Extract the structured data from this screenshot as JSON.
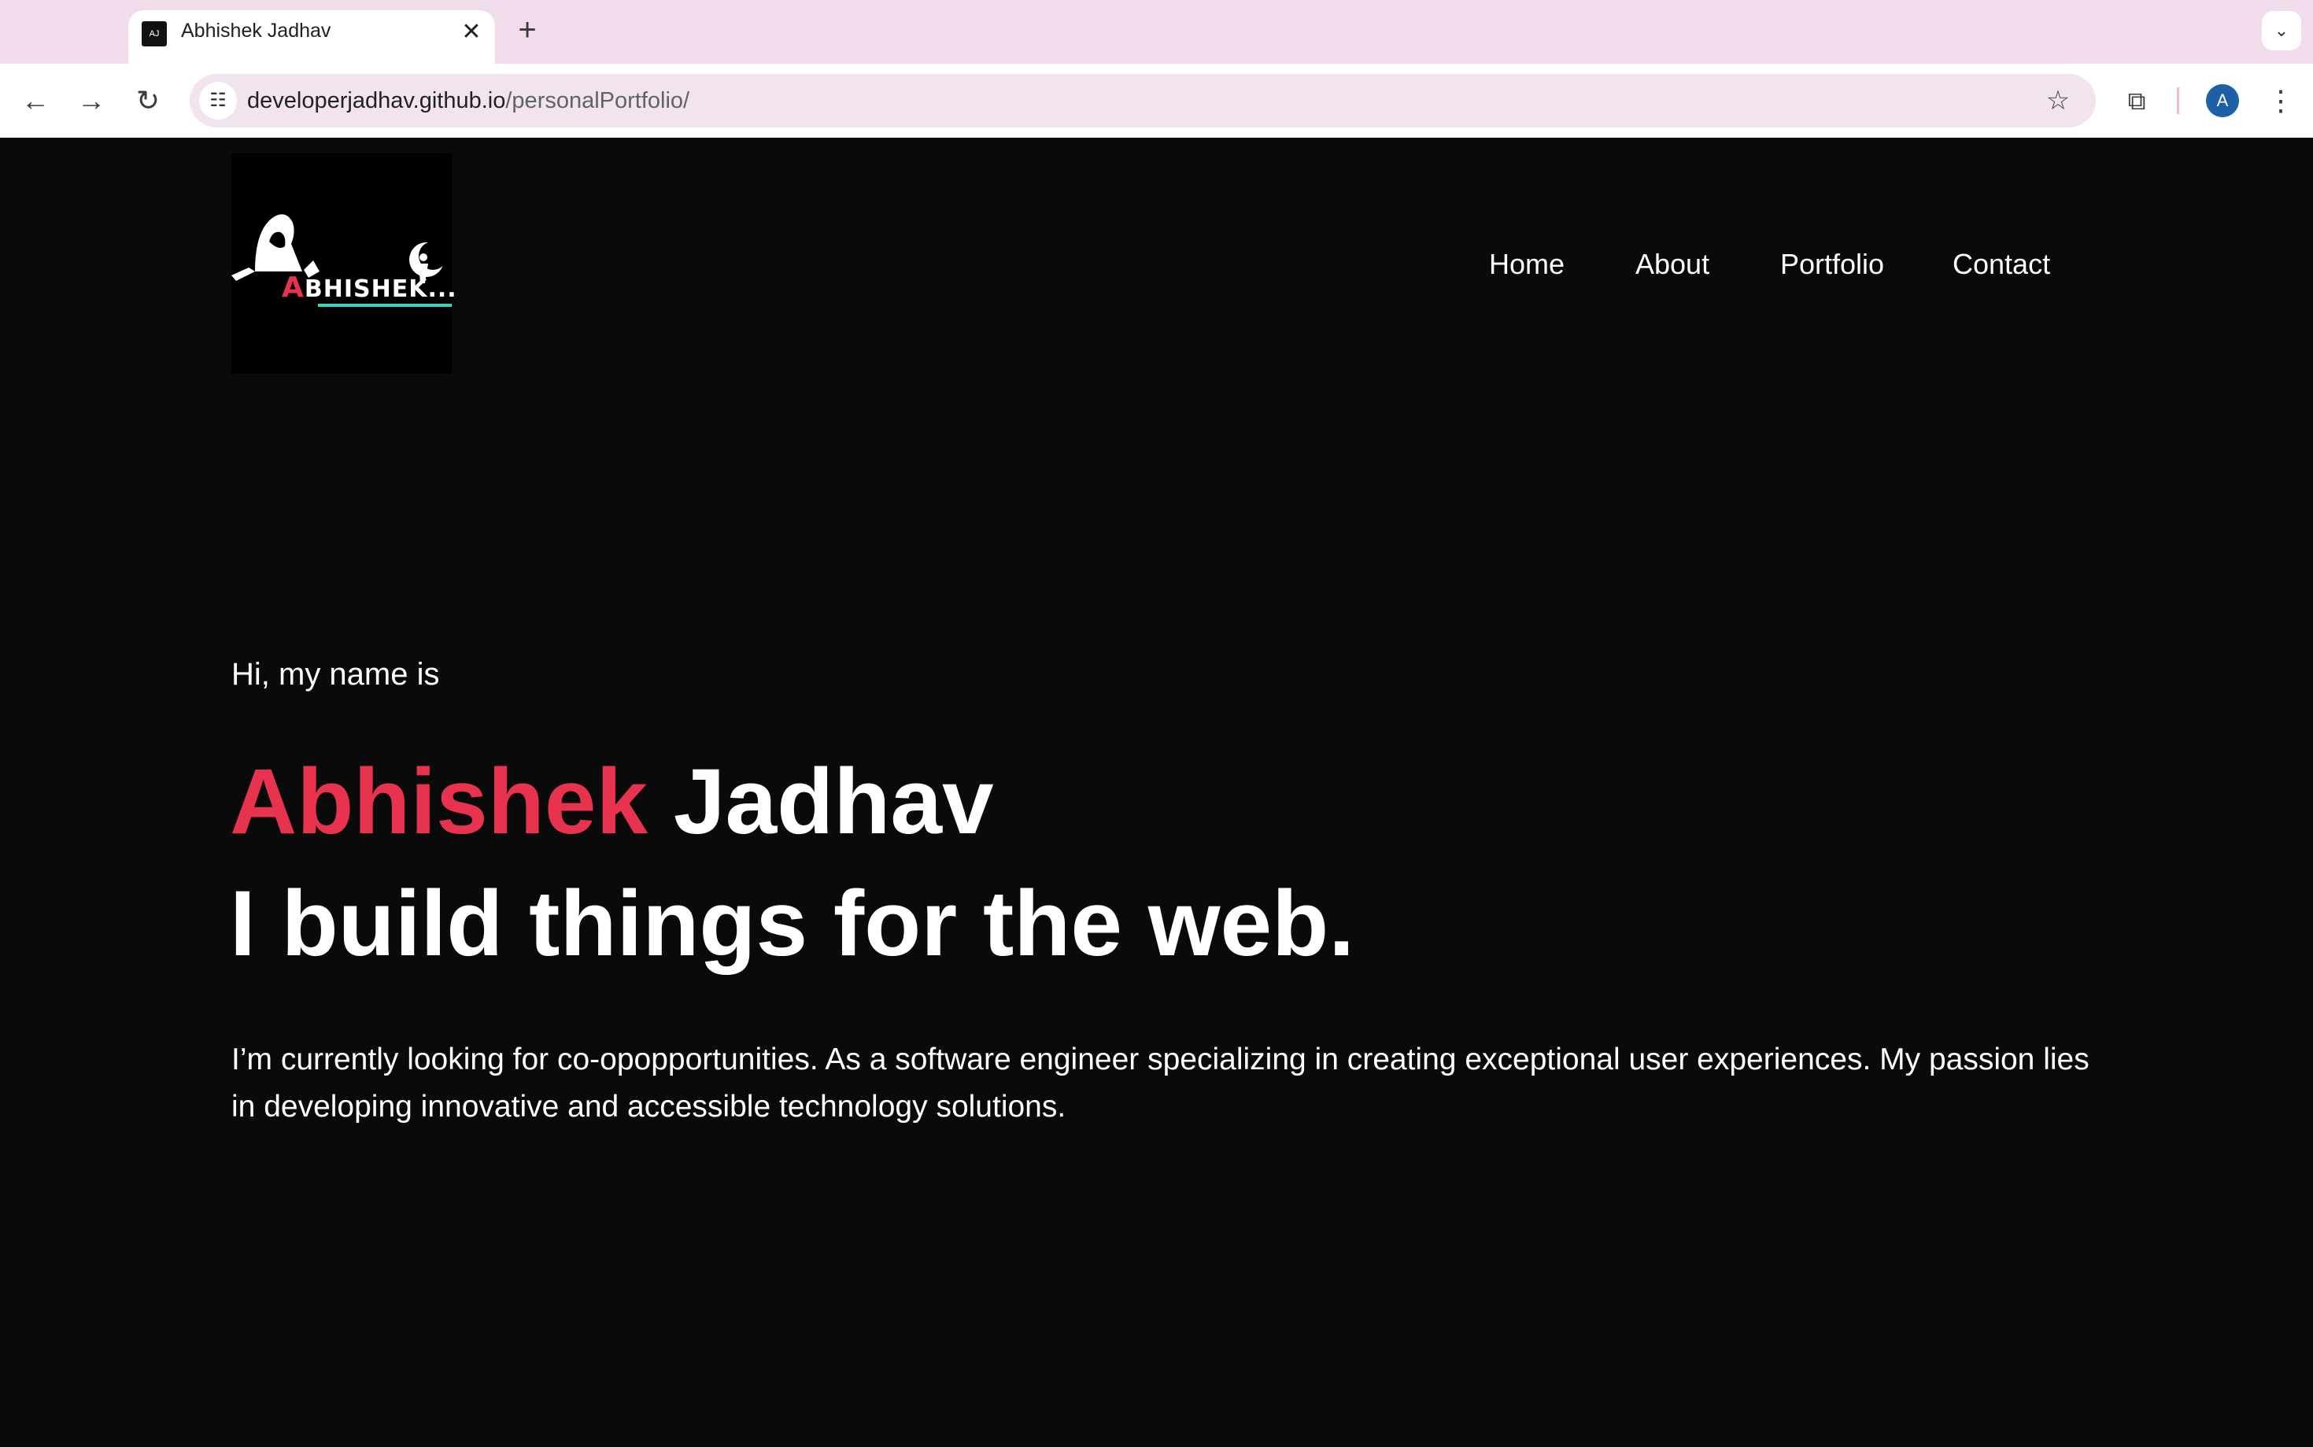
{
  "browser": {
    "tab": {
      "favicon_text": "AJ",
      "title": "Abhishek Jadhav",
      "close_glyph": "✕"
    },
    "new_tab_glyph": "+",
    "tab_search_glyph": "⌄",
    "toolbar": {
      "back_glyph": "←",
      "forward_glyph": "→",
      "reload_glyph": "↻",
      "site_info_glyph": "☷",
      "url_domain": "developerjadhav.github.io",
      "url_path": "/personalPortfolio/",
      "star_glyph": "☆",
      "extensions_glyph": "⧉",
      "avatar_letter": "A",
      "menu_glyph": "⋮"
    }
  },
  "site": {
    "logo": {
      "first_letter": "A",
      "rest": "BHISHEK..."
    },
    "nav": [
      "Home",
      "About",
      "Portfolio",
      "Contact"
    ],
    "hero": {
      "greeting": "Hi, my name is",
      "first_name": "Abhishek",
      "last_name": "Jadhav",
      "tagline": "I build things for the web.",
      "intro": "I’m currently looking for co-opopportunities. As a software engineer specializing in creating exceptional user experiences. My passion lies in developing innovative and accessible technology solutions."
    }
  },
  "colors": {
    "accent": "#e8334f",
    "page_background": "#0a0a0a",
    "tabstrip": "#f1dcec",
    "avatar": "#1f5fa8"
  }
}
